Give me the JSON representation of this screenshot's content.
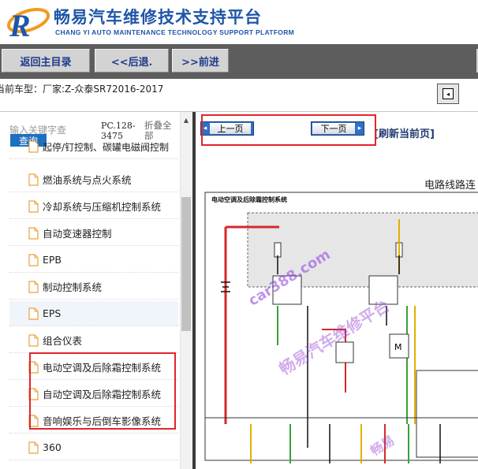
{
  "header": {
    "title": "畅易汽车维修技术支持平台",
    "subtitle": "CHANG YI AUTO MAINTENANCE TECHNOLOGY SUPPORT PLATFORM"
  },
  "toolbar": {
    "back_main_label": "返回主目录",
    "back_label": "<<后退.",
    "forward_label": ">>前进"
  },
  "car": {
    "label": "当前车型：厂家:Z-众泰SR72016-2017"
  },
  "left_panel": {
    "search_placeholder": "输入关键字查",
    "query_label": "查询",
    "pc_code": "PC.128-3475",
    "collapse_label": "折叠全部",
    "cut_item": "起停/钉控制、碳罐电磁阀控制",
    "items": [
      {
        "label": "燃油系统与点火系统"
      },
      {
        "label": "冷却系统与压缩机控制系统"
      },
      {
        "label": "自动变速器控制"
      },
      {
        "label": "EPB"
      },
      {
        "label": "制动控制系统"
      },
      {
        "label": "EPS"
      },
      {
        "label": "组合仪表"
      },
      {
        "label": "电动空调及后除霜控制系统"
      },
      {
        "label": "自动空调及后除霜控制系统"
      },
      {
        "label": "音响娱乐与后倒车影像系统"
      },
      {
        "label": "360"
      }
    ]
  },
  "right_panel": {
    "prev_label": "上一页",
    "next_label": "下一页",
    "refresh_label": "[刷新当前页]",
    "doc_title": "电路线路连",
    "diagram_title": "电动空调及后除霜控制系统",
    "watermark1": "car388.com",
    "watermark2": "畅易汽车维修平台",
    "watermark3": "畅易"
  },
  "colors": {
    "brand_blue": "#1f56a8",
    "toolbar_bg": "#5d5d5d",
    "highlight_red": "#e0262b"
  }
}
